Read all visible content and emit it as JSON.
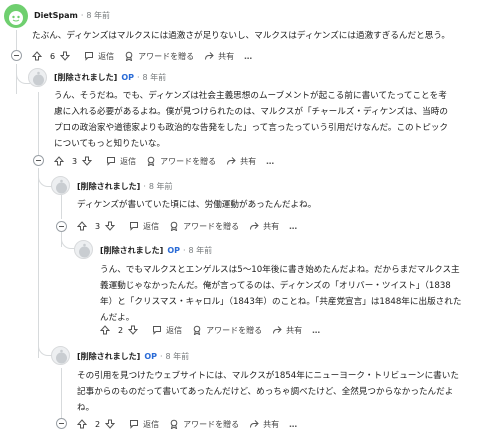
{
  "comments": [
    {
      "author": "DietSpam",
      "time": "8 年前",
      "text": "たぶん、ディケンズはマルクスには過激さが足りないし、マルクスはディケンズには過激すぎるんだと思う。",
      "score": "6",
      "reply": "返信",
      "award": "アワードを贈る",
      "share": "共有",
      "more": "…"
    },
    {
      "author": "[削除されました]",
      "op": "OP",
      "time": "8 年前",
      "text_lines": [
        "うん、そうだね。でも、ディケンズは社会主義思想のムーブメントが起こる前に書いてたってことを考",
        "慮に入れる必要があるよね。僕が見つけられたのは、マルクスが「チャールズ・ディケンズは、当時の",
        "プロの政治家や道徳家よりも政治的な告発をした」って言ったっていう引用だけなんだ。このトピック",
        "についてもっと知りたいな。"
      ],
      "score": "3",
      "reply": "返信",
      "award": "アワードを贈る",
      "share": "共有",
      "more": "…"
    },
    {
      "author": "[削除されました]",
      "time": "8 年前",
      "text": "ディケンズが書いていた頃には、労働運動があったんだよね。",
      "score": "3",
      "reply": "返信",
      "award": "アワードを贈る",
      "share": "共有",
      "more": "…"
    },
    {
      "author": "[削除されました]",
      "op": "OP",
      "time": "8 年前",
      "text_lines": [
        "うん、でもマルクスとエンゲルスは5～10年後に書き始めたんだよね。だからまだマルクス主",
        "義運動じゃなかったんだ。俺が言ってるのは、ディケンズの「オリバー・ツイスト」（1838",
        "年）と「クリスマス・キャロル」（1843年）のことね。「共産党宣言」は1848年に出版された",
        "んだよ。"
      ],
      "score": "2",
      "reply": "返信",
      "award": "アワードを贈る",
      "share": "共有",
      "more": "…"
    },
    {
      "author": "[削除されました]",
      "op": "OP",
      "time": "8 年前",
      "text_lines": [
        "その引用を見つけたウェブサイトには、マルクスが1854年にニューヨーク・トリビューンに書いた",
        "記事からのものだって書いてあったんだけど、めっちゃ調べたけど、全然見つからなかったんだよ",
        "ね。"
      ],
      "score": "2",
      "reply": "返信",
      "award": "アワードを贈る",
      "share": "共有",
      "more": "…"
    }
  ],
  "colors": {
    "op": "#2a6bd6",
    "muted": "#787c7e",
    "thread_line": "#d7dadc",
    "avatar_green": "#6fcf6f"
  },
  "icons": [
    "upvote-icon",
    "downvote-icon",
    "reply-icon",
    "award-icon",
    "share-icon",
    "more-icon",
    "collapse-icon",
    "snoo-avatar-icon"
  ]
}
